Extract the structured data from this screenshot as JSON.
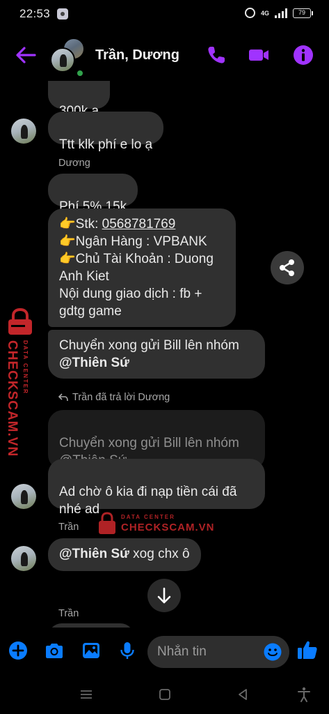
{
  "status_bar": {
    "time": "22:53",
    "network": "4G",
    "battery": "79"
  },
  "header": {
    "contact_name": "Trần, Dương",
    "accent_color": "#a033ff",
    "icons": [
      "back-arrow-icon",
      "phone-icon",
      "video-camera-icon",
      "info-icon"
    ]
  },
  "messages": {
    "m1": "300k a",
    "m2": "Ttt klk phí e lo ạ",
    "sender_duong": "Dương",
    "m3": "Phí 5% 15k",
    "m4_prefix": "👉Stk: ",
    "m4_account": "0568781769",
    "m4_rest": "👉Ngân Hàng : VPBANK\n👉Chủ Tài Khoản : Duong\nAnh Kiet\nNội dung giao dịch : fb +\ngdtg game",
    "m5_text": "Chuyển xong gửi Bill lên nhóm",
    "m5_mention": "@Thiên Sứ",
    "reply_note": "Trần đã trả lời Dương",
    "quoted": "Chuyển xong gửi Bill lên nhóm\n@Thiên Sứ",
    "m6": "Ad chờ ô kia đi nạp tiền cái đã\nnhé ad",
    "sender_tran_1": "Trần",
    "m7_mention": "@Thiên Sứ",
    "m7_text": "  xog chx ô",
    "sender_tran_2": "Trần"
  },
  "watermark": {
    "brand": "CHECKSCAM.VN",
    "sub": "DATA CENTER",
    "color": "#c2262a"
  },
  "composer": {
    "placeholder": "Nhắn tin",
    "icons": [
      "plus-icon",
      "camera-icon",
      "gallery-icon",
      "microphone-icon",
      "emoji-icon",
      "like-icon"
    ]
  }
}
